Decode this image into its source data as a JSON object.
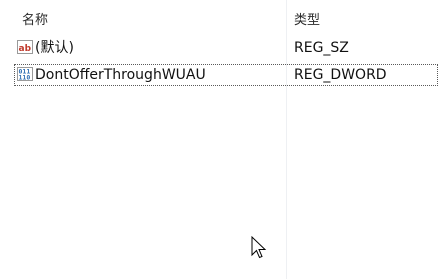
{
  "columns": {
    "name": "名称",
    "type": "类型"
  },
  "rows": [
    {
      "icon": "string-value-icon",
      "name": "(默认)",
      "type": "REG_SZ"
    },
    {
      "icon": "binary-value-icon",
      "name": "DontOfferThroughWUAU",
      "type": "REG_DWORD",
      "selected": true
    }
  ],
  "colors": {
    "string_icon": "#c0392b",
    "binary_icon": "#2e6fb5",
    "separator": "#eef0f3"
  }
}
